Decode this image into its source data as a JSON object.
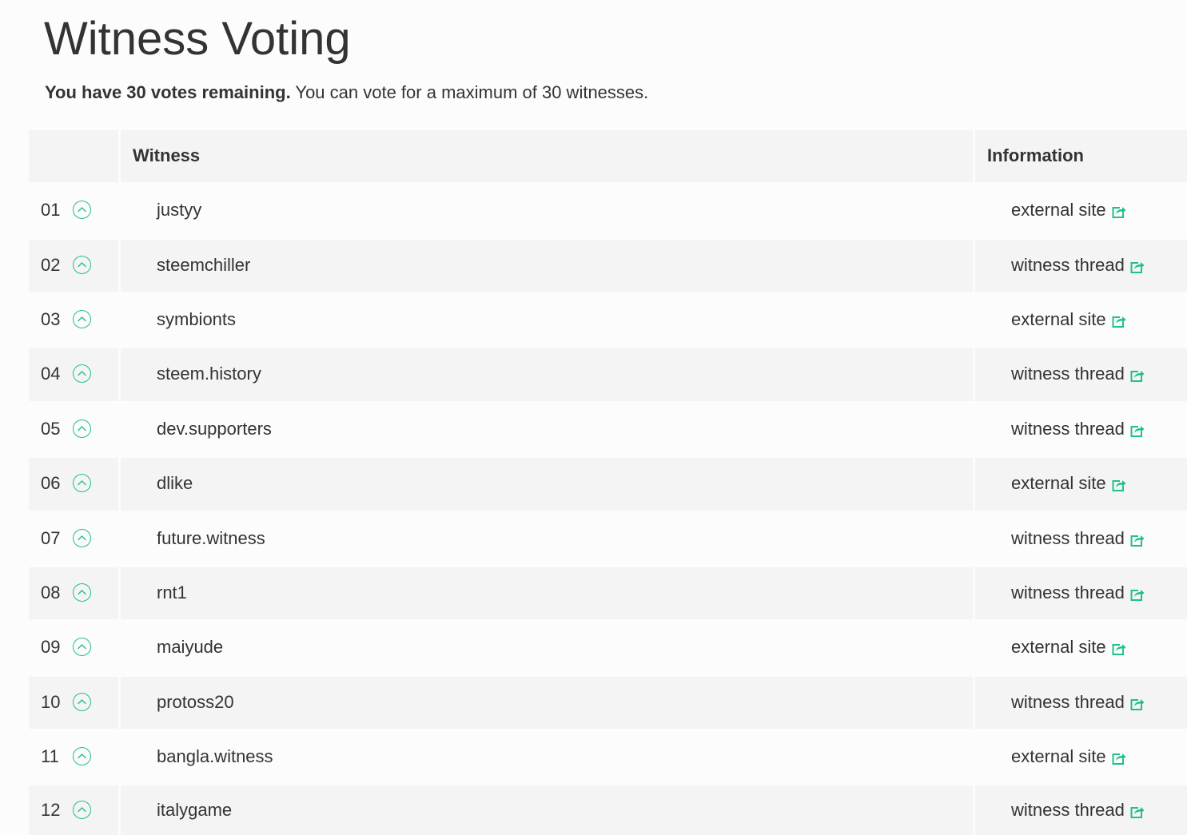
{
  "page": {
    "title": "Witness Voting",
    "votes_bold": "You have 30 votes remaining.",
    "votes_rest": " You can vote for a maximum of 30 witnesses."
  },
  "table": {
    "headers": {
      "rank": "",
      "witness": "Witness",
      "information": "Information"
    },
    "rows": [
      {
        "rank": "01",
        "witness": "justyy",
        "info": "external site"
      },
      {
        "rank": "02",
        "witness": "steemchiller",
        "info": "witness thread"
      },
      {
        "rank": "03",
        "witness": "symbionts",
        "info": "external site"
      },
      {
        "rank": "04",
        "witness": "steem.history",
        "info": "witness thread"
      },
      {
        "rank": "05",
        "witness": "dev.supporters",
        "info": "witness thread"
      },
      {
        "rank": "06",
        "witness": "dlike",
        "info": "external site"
      },
      {
        "rank": "07",
        "witness": "future.witness",
        "info": "witness thread"
      },
      {
        "rank": "08",
        "witness": "rnt1",
        "info": "witness thread"
      },
      {
        "rank": "09",
        "witness": "maiyude",
        "info": "external site"
      },
      {
        "rank": "10",
        "witness": "protoss20",
        "info": "witness thread"
      },
      {
        "rank": "11",
        "witness": "bangla.witness",
        "info": "external site"
      },
      {
        "rank": "12",
        "witness": "italygame",
        "info": "witness thread"
      }
    ]
  },
  "colors": {
    "accent": "#1fbf8f",
    "row_alt": "#f4f4f4",
    "background": "#fcfcfc",
    "text": "#333333"
  },
  "icons": {
    "vote": "chevron-up-circle-icon",
    "link": "external-link-icon"
  }
}
